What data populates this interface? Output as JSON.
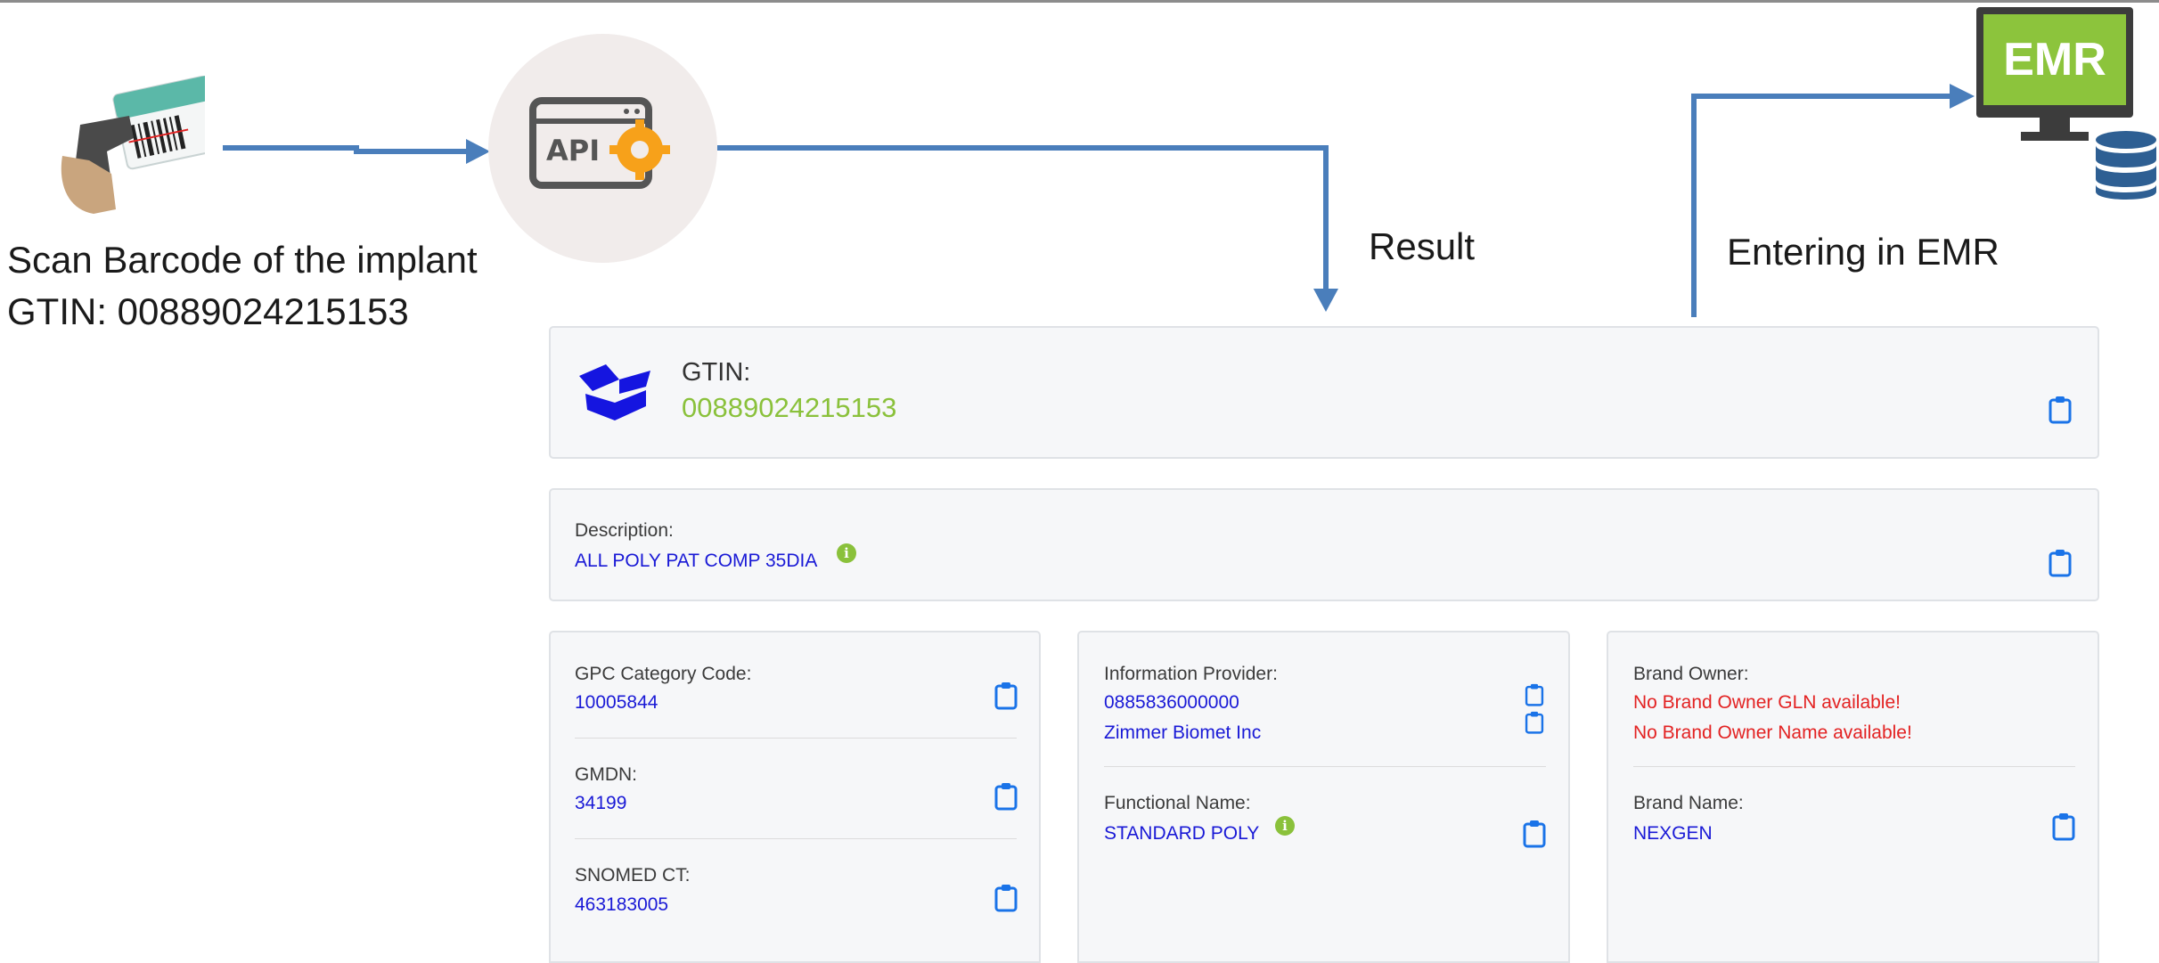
{
  "flow": {
    "scan_line1": "Scan Barcode of the implant",
    "scan_line2": "GTIN: 00889024215153",
    "api_label": "API",
    "result_label": "Result",
    "entering_label": "Entering in EMR",
    "emr_label": "EMR"
  },
  "gtin_card": {
    "label": "GTIN:",
    "value": "00889024215153"
  },
  "description_card": {
    "label": "Description:",
    "value": "ALL POLY PAT COMP 35DIA"
  },
  "left_card": {
    "gpc_label": "GPC Category Code:",
    "gpc_value": "10005844",
    "gmdn_label": "GMDN:",
    "gmdn_value": "34199",
    "snomed_label": "SNOMED CT:",
    "snomed_value": "463183005"
  },
  "middle_card": {
    "provider_label": "Information Provider:",
    "provider_gln": "0885836000000",
    "provider_name": "Zimmer Biomet Inc",
    "functional_label": "Functional Name:",
    "functional_value": "STANDARD POLY"
  },
  "right_card": {
    "owner_label": "Brand Owner:",
    "owner_gln_missing": "No Brand Owner GLN available!",
    "owner_name_missing": "No Brand Owner Name available!",
    "brand_label": "Brand Name:",
    "brand_value": "NEXGEN"
  },
  "colors": {
    "arrow": "#4a7ebb",
    "value": "#1919d6",
    "gtin": "#8ac13b",
    "error": "#e32222",
    "clipboard": "#1a73e8",
    "emr_screen": "#8cc43c"
  },
  "icons": [
    "barcode-scanner-icon",
    "api-gear-icon",
    "emr-monitor-icon",
    "database-icon",
    "box-icon",
    "clipboard-icon",
    "info-icon"
  ]
}
